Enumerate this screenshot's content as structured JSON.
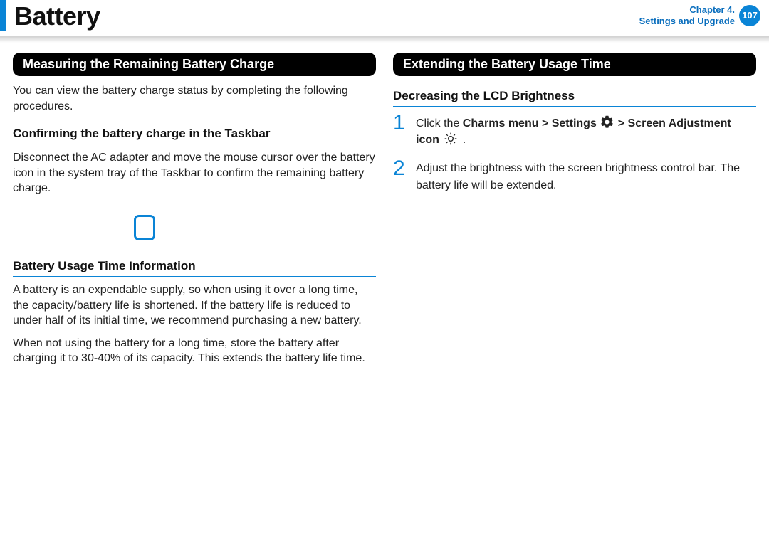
{
  "header": {
    "title": "Battery",
    "chapter_line1": "Chapter 4.",
    "chapter_line2": "Settings and Upgrade",
    "page_number": "107"
  },
  "left": {
    "section_title": "Measuring the Remaining Battery Charge",
    "intro": "You can view the battery charge status by completing the following procedures.",
    "sub1_heading": "Confirming the battery charge in the Taskbar",
    "sub1_body": "Disconnect the AC adapter and move the mouse cursor over the battery icon in the system tray of the Taskbar to confirm the remaining battery charge.",
    "sub2_heading": "Battery Usage Time Information",
    "sub2_body1": "A battery is an expendable supply, so when using it over a long time, the capacity/battery life is shortened. If the battery life is reduced to under half of its initial time, we recommend purchasing a new battery.",
    "sub2_body2": "When not using the battery for a long time, store the battery after charging it to 30-40% of its capacity. This extends the battery life time."
  },
  "right": {
    "section_title": "Extending the Battery Usage Time",
    "sub1_heading": "Decreasing the LCD Brightness",
    "step1_a": "Click the ",
    "step1_b": "Charms menu > Settings",
    "step1_c": " > Screen Adjustment icon",
    "step1_end": " .",
    "step2": "Adjust the brightness with the screen brightness control bar. The battery life will be extended."
  }
}
